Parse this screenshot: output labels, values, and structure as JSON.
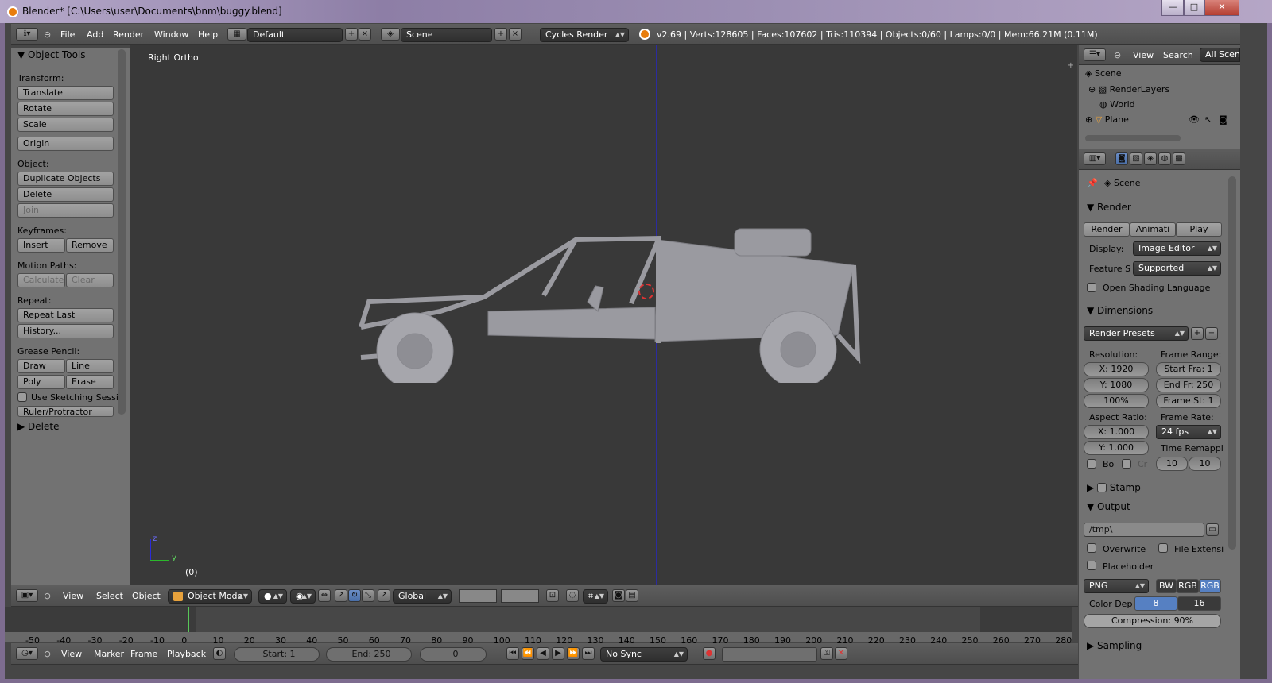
{
  "window": {
    "title": "Blender* [C:\\Users\\user\\Documents\\bnm\\buggy.blend]",
    "minimize": "—",
    "maximize": "□",
    "close": "✕"
  },
  "info_header": {
    "menus": [
      "File",
      "Add",
      "Render",
      "Window",
      "Help"
    ],
    "layout": "Default",
    "scene": "Scene",
    "engine": "Cycles Render",
    "stats": "v2.69 | Verts:128605 | Faces:107602 | Tris:110394 | Objects:0/60 | Lamps:0/0 | Mem:66.21M (0.11M)"
  },
  "toolshelf": {
    "title": "Object Tools",
    "transform_label": "Transform:",
    "translate": "Translate",
    "rotate": "Rotate",
    "scale": "Scale",
    "origin": "Origin",
    "object_label": "Object:",
    "duplicate": "Duplicate Objects",
    "delete": "Delete",
    "join": "Join",
    "keyframes_label": "Keyframes:",
    "insert": "Insert",
    "remove": "Remove",
    "motion_label": "Motion Paths:",
    "calculate": "Calculate",
    "clear": "Clear",
    "repeat_label": "Repeat:",
    "repeat_last": "Repeat Last",
    "history": "History...",
    "grease_label": "Grease Pencil:",
    "draw": "Draw",
    "line": "Line",
    "poly": "Poly",
    "erase": "Erase",
    "sketching": "Use Sketching Sessi",
    "ruler": "Ruler/Protractor",
    "delete_panel": "Delete"
  },
  "viewport": {
    "view_name": "Right Ortho",
    "frame_indicator": "(0)",
    "axis_z": "z",
    "axis_y": "y"
  },
  "view_header": {
    "menus": [
      "View",
      "Select",
      "Object"
    ],
    "mode": "Object Mode",
    "orientation": "Global"
  },
  "timeline": {
    "ticks": [
      "-50",
      "-40",
      "-30",
      "-20",
      "-10",
      "0",
      "10",
      "20",
      "30",
      "40",
      "50",
      "60",
      "70",
      "80",
      "90",
      "100",
      "110",
      "120",
      "130",
      "140",
      "150",
      "160",
      "170",
      "180",
      "190",
      "200",
      "210",
      "220",
      "230",
      "240",
      "250",
      "260",
      "270",
      "280"
    ],
    "current_frame_marker": 0
  },
  "timeline_header": {
    "menus": [
      "View",
      "Marker",
      "Frame",
      "Playback"
    ],
    "start": "Start: 1",
    "end": "End: 250",
    "current": "0",
    "sync": "No Sync"
  },
  "outliner": {
    "menus": [
      "View",
      "Search"
    ],
    "filter": "All Scene",
    "items": [
      "Scene",
      "RenderLayers",
      "World",
      "Plane"
    ]
  },
  "properties": {
    "context": "Scene",
    "render_panel": "Render",
    "render_btn": "Render",
    "anim_btn": "Animati",
    "play_btn": "Play",
    "display_label": "Display:",
    "display_value": "Image Editor",
    "feature_label": "Feature S",
    "feature_value": "Supported",
    "osl": "Open Shading Language",
    "dimensions_panel": "Dimensions",
    "presets": "Render Presets",
    "resolution_label": "Resolution:",
    "res_x": "X: 1920",
    "res_y": "Y: 1080",
    "res_pct": "100%",
    "frame_range_label": "Frame Range:",
    "start_fra": "Start Fra: 1",
    "end_fr": "End Fr: 250",
    "frame_st": "Frame St: 1",
    "aspect_label": "Aspect Ratio:",
    "asp_x": "X: 1.000",
    "asp_y": "Y: 1.000",
    "frame_rate_label": "Frame Rate:",
    "fps": "24 fps",
    "time_remap_label": "Time Remappi",
    "remap_old": "10",
    "remap_new": "10",
    "border": "Bo",
    "crop": "Cr",
    "stamp_panel": "Stamp",
    "output_panel": "Output",
    "output_path": "/tmp\\",
    "overwrite": "Overwrite",
    "file_ext": "File Extensi",
    "placeholder": "Placeholder",
    "format": "PNG",
    "bw": "BW",
    "rgb": "RGB",
    "rgba": "RGB",
    "color_depth_label": "Color Dep",
    "depth_8": "8",
    "depth_16": "16",
    "compression": "Compression: 90%",
    "sampling_panel": "Sampling"
  }
}
